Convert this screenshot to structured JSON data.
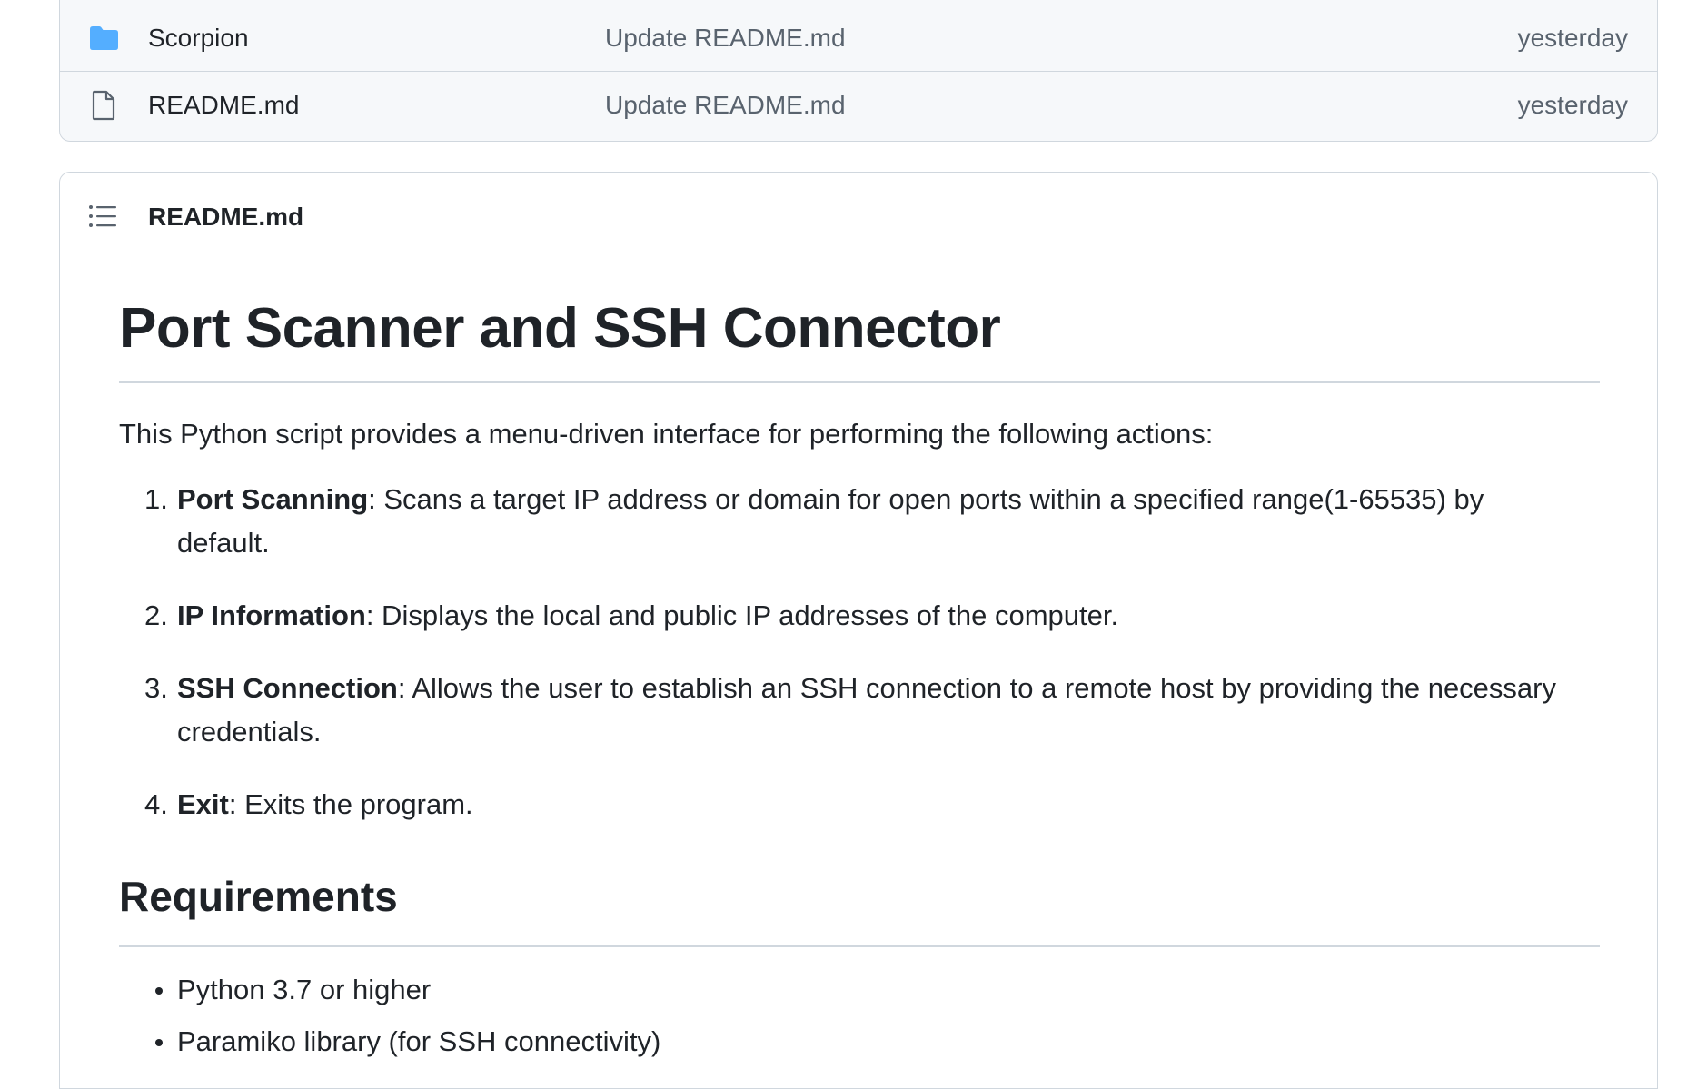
{
  "files": [
    {
      "name": "Scorpion",
      "type": "folder",
      "icon": "folder-icon",
      "commit": "Update README.md",
      "date": "yesterday"
    },
    {
      "name": "README.md",
      "type": "file",
      "icon": "file-icon",
      "commit": "Update README.md",
      "date": "yesterday"
    }
  ],
  "readme": {
    "header_title": "README.md",
    "title": "Port Scanner and SSH Connector",
    "intro": "This Python script provides a menu-driven interface for performing the following actions:",
    "actions": [
      {
        "num": "1.",
        "label": "Port Scanning",
        "desc": ": Scans a target IP address or domain for open ports within a specified range(1-65535) by default."
      },
      {
        "num": "2.",
        "label": "IP Information",
        "desc": ": Displays the local and public IP addresses of the computer."
      },
      {
        "num": "3.",
        "label": "SSH Connection",
        "desc": ": Allows the user to establish an SSH connection to a remote host by providing the necessary credentials."
      },
      {
        "num": "4.",
        "label": "Exit",
        "desc": ": Exits the program."
      }
    ],
    "requirements_heading": "Requirements",
    "requirements": [
      "Python 3.7 or higher",
      "Paramiko library (for SSH connectivity)"
    ]
  },
  "colors": {
    "folder": "#54aeff",
    "border": "#d0d7de",
    "muted": "#59636e",
    "text": "#1f2328"
  }
}
